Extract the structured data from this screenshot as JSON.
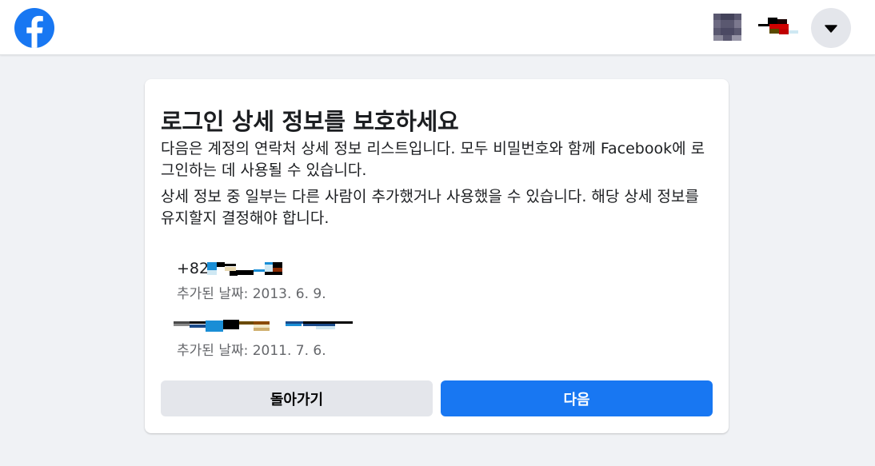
{
  "header": {
    "logo_icon": "facebook-logo-icon",
    "menu_icon": "caret-down-icon",
    "accent_color": "#1877f2"
  },
  "card": {
    "title": "로그인 상세 정보를 보호하세요",
    "description_1": "다음은 계정의 연락처 상세 정보 리스트입니다. 모두 비밀번호와 함께 Facebook에 로그인하는 데 사용될 수 있습니다.",
    "description_2": "상세 정보 중 일부는 다른 사람이 추가했거나 사용했을 수 있습니다. 해당 상세 정보를 유지할지 결정해야 합니다.",
    "entries": [
      {
        "value_prefix": "+82",
        "date": "추가된 날짜: 2013. 6. 9."
      },
      {
        "value_prefix": "",
        "date": "추가된 날짜: 2011. 7. 6."
      }
    ],
    "back_label": "돌아가기",
    "next_label": "다음"
  }
}
